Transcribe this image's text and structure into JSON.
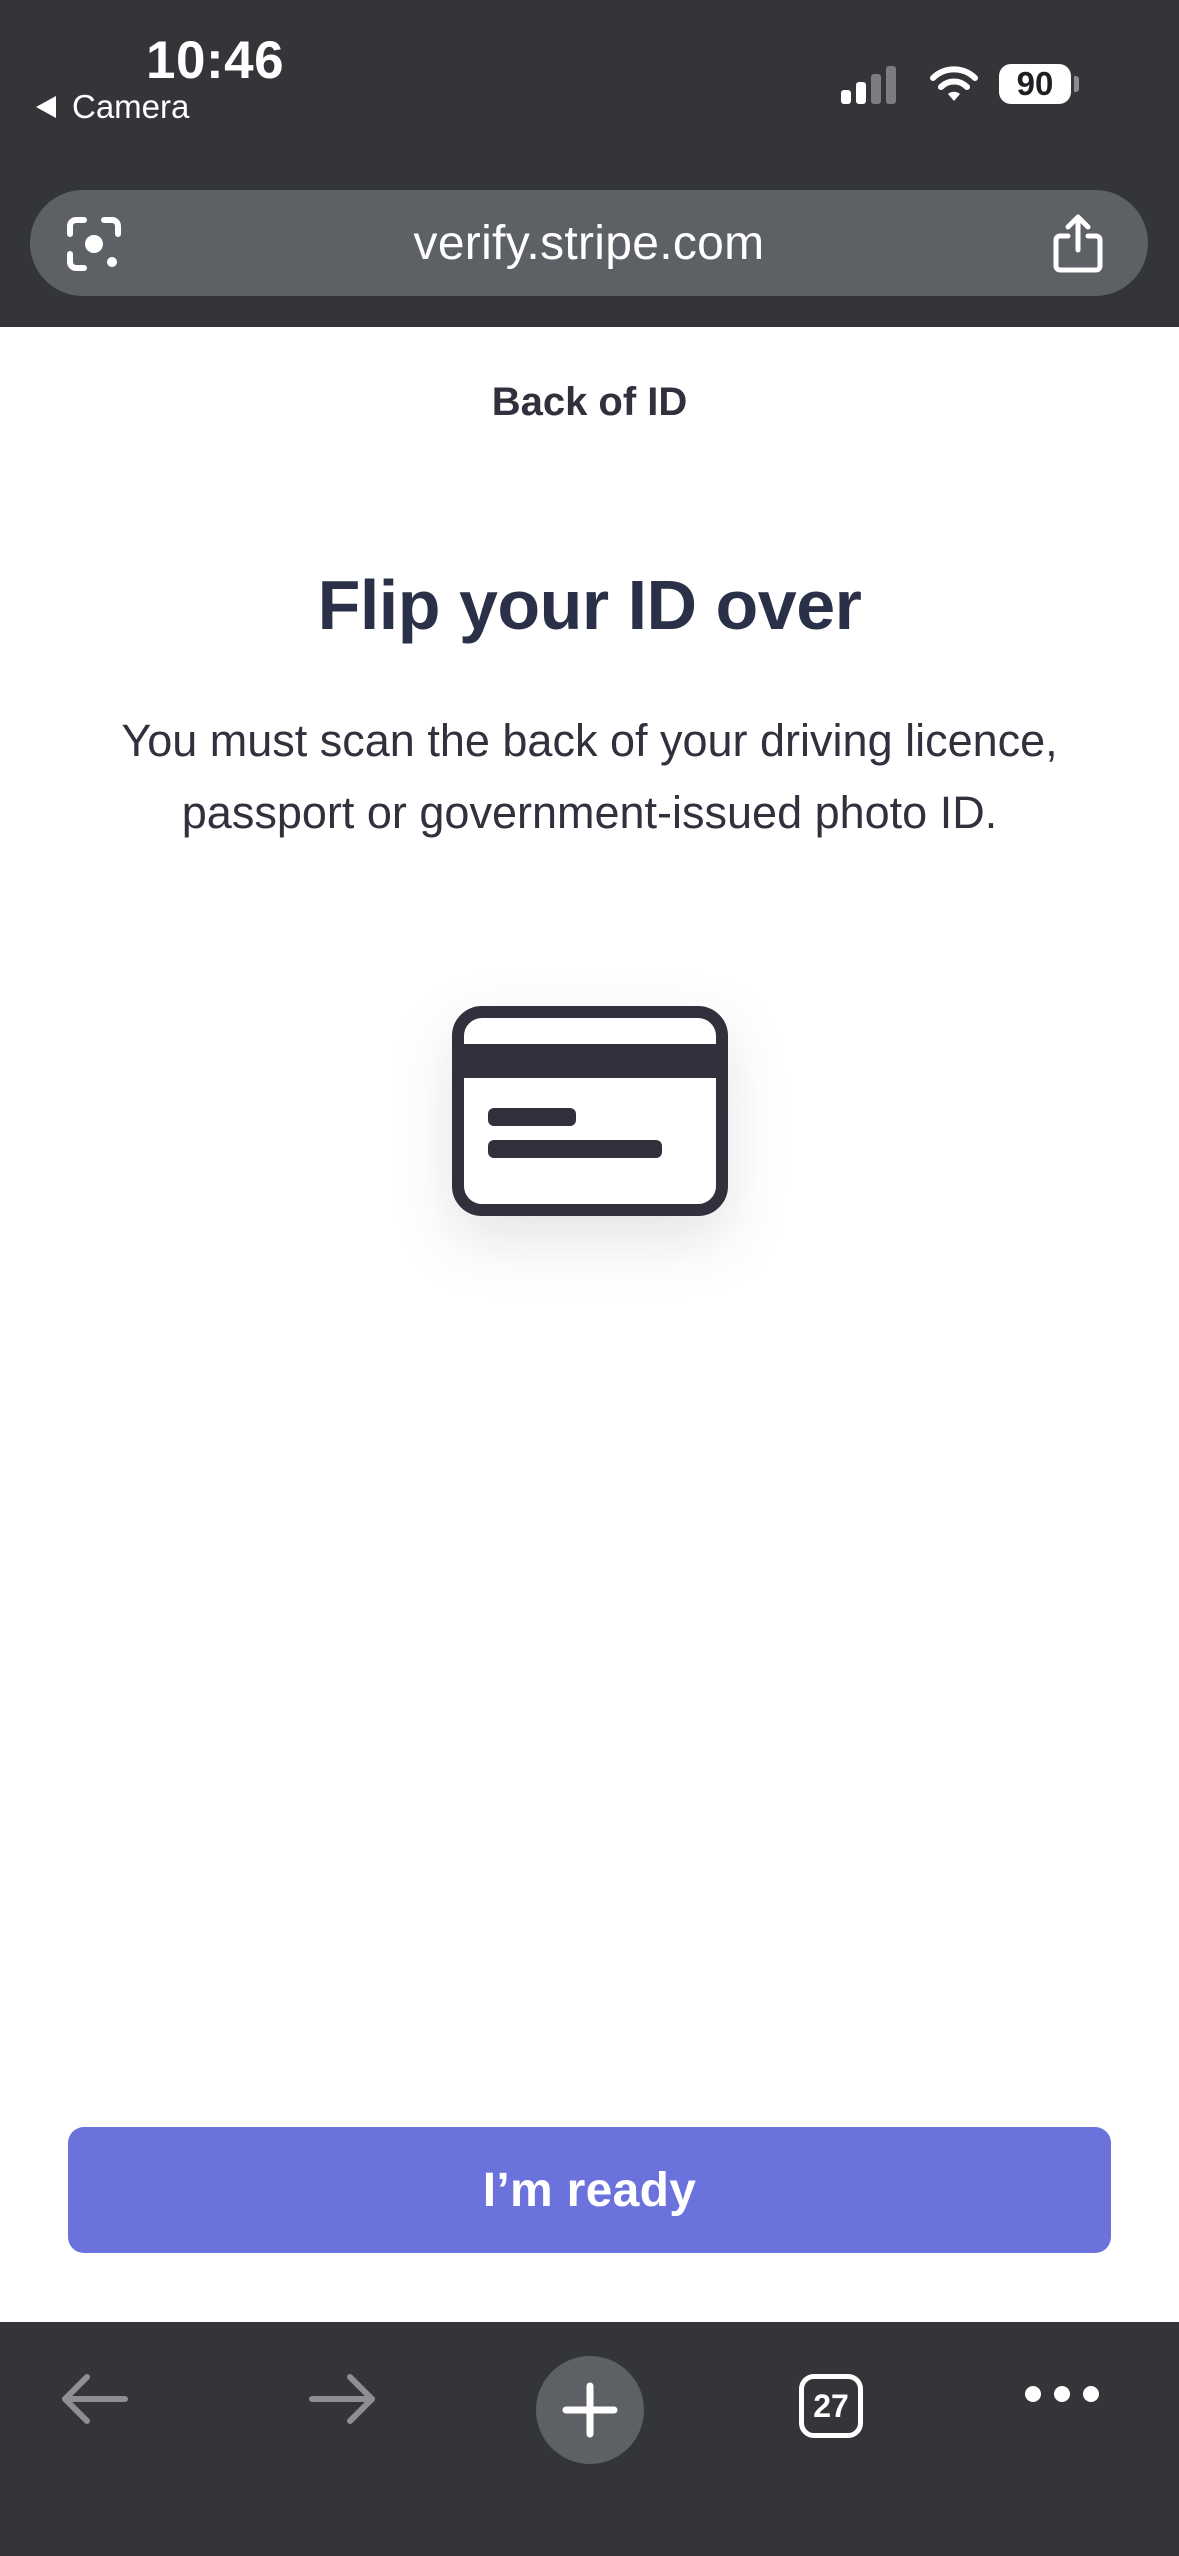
{
  "status_bar": {
    "time": "10:46",
    "back_app_label": "Camera",
    "battery_level": "90"
  },
  "browser": {
    "url": "verify.stripe.com",
    "tab_count": "27"
  },
  "content": {
    "eyebrow": "Back of ID",
    "title": "Flip your ID over",
    "body": "You must scan the back of your driving licence, passport or government-issued photo ID."
  },
  "actions": {
    "ready_label": "I’m ready"
  },
  "colors": {
    "chrome": "#333539",
    "url_bar": "#5d6065",
    "accent": "#6b72dc",
    "heading": "#2a3047"
  },
  "icons": {
    "url_bar_left": "google-lens-icon",
    "url_bar_right": "share-icon",
    "toolbar": [
      "back-arrow-icon",
      "forward-arrow-icon",
      "plus-icon",
      "tab-switcher-icon",
      "more-dots-icon"
    ],
    "illustration": "id-card-back-icon"
  }
}
